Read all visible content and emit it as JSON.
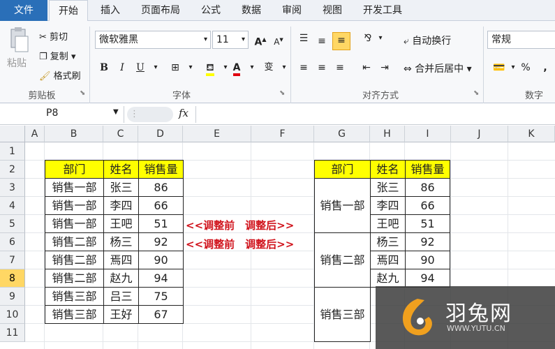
{
  "tabs": [
    "文件",
    "开始",
    "插入",
    "页面布局",
    "公式",
    "数据",
    "审阅",
    "视图",
    "开发工具"
  ],
  "clipboard": {
    "paste": "粘贴",
    "cut": "剪切",
    "copy": "复制",
    "format_painter": "格式刷",
    "group": "剪贴板"
  },
  "font": {
    "name": "微软雅黑",
    "size": "11",
    "group": "字体",
    "bold": "B",
    "italic": "I",
    "underline": "U",
    "grow": "A",
    "shrink": "A",
    "font_color_glyph": "A",
    "phonetic": "变"
  },
  "alignment": {
    "wrap": "自动换行",
    "merge": "合并后居中",
    "group": "对齐方式"
  },
  "number": {
    "format": "常规",
    "percent": "%",
    "comma": ",",
    "group": "数字"
  },
  "formula_bar": {
    "name_box": "P8",
    "fx": "fx",
    "formula": ""
  },
  "columns": [
    "A",
    "B",
    "C",
    "D",
    "E",
    "F",
    "G",
    "H",
    "I",
    "J",
    "K"
  ],
  "rows": [
    "1",
    "2",
    "3",
    "4",
    "5",
    "6",
    "7",
    "8",
    "9",
    "10",
    "11"
  ],
  "selected_row": "8",
  "left_table": {
    "headers": [
      "部门",
      "姓名",
      "销售量"
    ],
    "rows": [
      [
        "销售一部",
        "张三",
        "86"
      ],
      [
        "销售一部",
        "李四",
        "66"
      ],
      [
        "销售一部",
        "王吧",
        "51"
      ],
      [
        "销售二部",
        "杨三",
        "92"
      ],
      [
        "销售二部",
        "焉四",
        "90"
      ],
      [
        "销售二部",
        "赵九",
        "94"
      ],
      [
        "销售三部",
        "吕三",
        "75"
      ],
      [
        "销售三部",
        "王好",
        "67"
      ]
    ]
  },
  "arrows": [
    "<<调整前　调整后>>",
    "<<调整前　调整后>>"
  ],
  "right_table": {
    "headers": [
      "部门",
      "姓名",
      "销售量"
    ],
    "groups": [
      "销售一部",
      "销售二部",
      "销售三部"
    ],
    "rows": [
      [
        "张三",
        "86"
      ],
      [
        "李四",
        "66"
      ],
      [
        "王吧",
        "51"
      ],
      [
        "杨三",
        "92"
      ],
      [
        "焉四",
        "90"
      ],
      [
        "赵九",
        "94"
      ]
    ]
  },
  "watermark": {
    "name": "羽兔网",
    "url": "WWW.YUTU.CN"
  },
  "colors": {
    "header_fill": "#ffff00",
    "arrow_text": "#d0121b",
    "active_tab": "#ffffff"
  }
}
